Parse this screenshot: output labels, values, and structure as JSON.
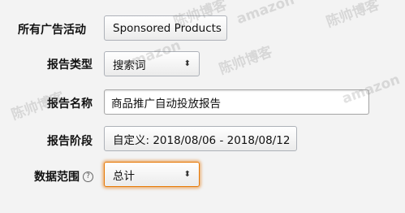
{
  "form": {
    "campaign": {
      "label": "所有广告活动",
      "value": "Sponsored Products"
    },
    "report_type": {
      "label": "报告类型",
      "value": "搜索词"
    },
    "report_name": {
      "label": "报告名称",
      "value": "商品推广自动投放报告"
    },
    "report_period": {
      "label": "报告阶段",
      "value": "自定义: 2018/08/06 - 2018/08/12"
    },
    "data_scope": {
      "label": "数据范围",
      "value": "总计",
      "help": "?"
    }
  },
  "icons": {
    "select_caret": "updown-caret-icon",
    "help": "question-circle-icon"
  },
  "colors": {
    "focus_border": "#e77600",
    "background": "#f3f3f3"
  },
  "watermark": [
    "陈帅博客",
    "amazon",
    "陈帅博客",
    "amazon",
    "陈帅博客",
    "amazon",
    "陈帅博客"
  ]
}
